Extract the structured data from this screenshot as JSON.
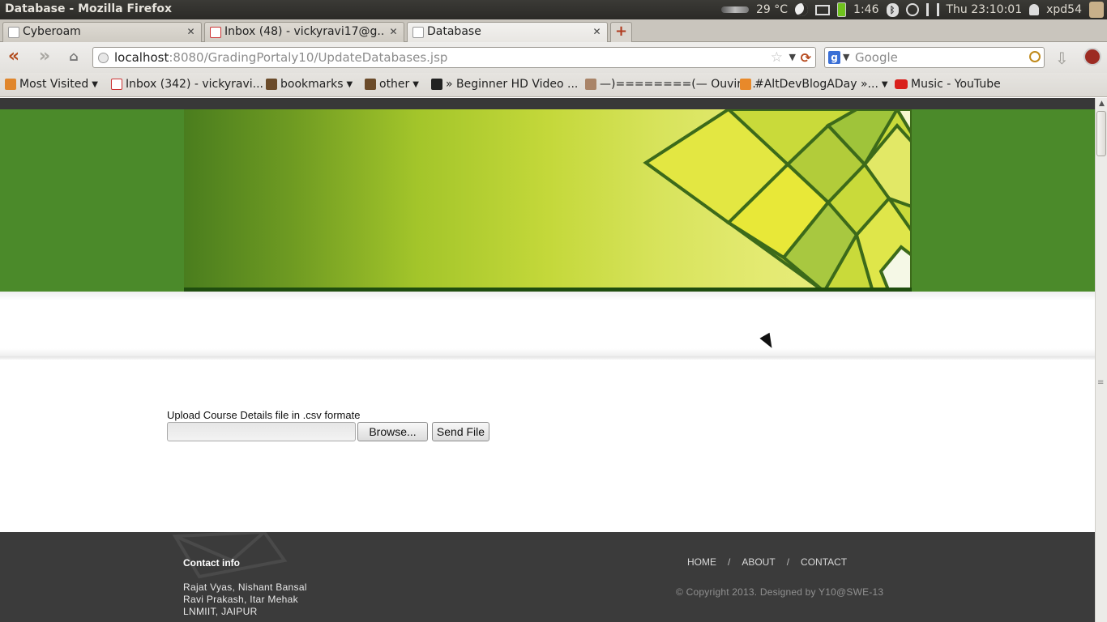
{
  "window": {
    "title": "Database - Mozilla Firefox"
  },
  "panel": {
    "temperature": "29 °C",
    "battery_time": "1:46",
    "clock": "Thu 23:10:01",
    "username": "xpd54"
  },
  "tabs": [
    {
      "label": "Cyberoam"
    },
    {
      "label": "Inbox (48) - vickyravi17@g..."
    },
    {
      "label": "Database"
    }
  ],
  "navigation": {
    "url_host": "localhost",
    "url_rest": ":8080/GradingPortaly10/UpdateDatabases.jsp",
    "search_placeholder": "Google"
  },
  "bookmarks": [
    {
      "label": "Most Visited"
    },
    {
      "label": "Inbox (342) - vickyravi..."
    },
    {
      "label": "bookmarks"
    },
    {
      "label": "other"
    },
    {
      "label": "» Beginner HD Video ..."
    },
    {
      "label": "—)========(— Ouvir ..."
    },
    {
      "label": "#AltDevBlogADay »..."
    },
    {
      "label": "Music - YouTube"
    }
  ],
  "upload": {
    "label": "Upload Course Details file in .csv formate",
    "browse_label": "Browse...",
    "send_label": "Send File"
  },
  "footer": {
    "contact_heading": "Contact info",
    "contact_lines": [
      "Rajat Vyas, Nishant Bansal",
      "Ravi Prakash, Itar Mehak",
      "LNMIIT, JAIPUR"
    ],
    "nav": [
      "HOME",
      "ABOUT",
      "CONTACT"
    ],
    "nav_separator": "/",
    "copyright": "© Copyright 2013. Designed by Y10@SWE-13"
  }
}
